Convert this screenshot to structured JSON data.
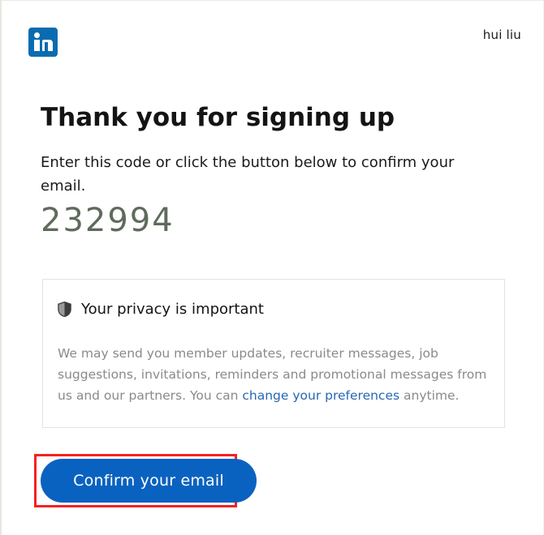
{
  "header": {
    "logo_icon": "linkedin-logo-icon",
    "logo_text": "in",
    "user_name": "hui liu"
  },
  "main": {
    "title": "Thank you for signing up",
    "subtitle": "Enter this code or click the button below to confirm your email.",
    "code": "232994"
  },
  "privacy": {
    "icon": "shield-icon",
    "title": "Your privacy is important",
    "body_before_link": "We may send you member updates, recruiter messages, job suggestions, invitations, reminders and promotional messages from us and our partners. You can ",
    "link_label": "change your preferences",
    "body_after_link": " anytime."
  },
  "cta": {
    "confirm_label": "Confirm your email"
  },
  "colors": {
    "linkedin_blue": "#0a6cb0",
    "button_blue": "#0a62c0",
    "link_blue": "#2867b2",
    "code_gray": "#5f6b5c",
    "body_gray": "#8a8a8a",
    "highlight_red": "#f72020",
    "box_border": "#e3e3e3"
  }
}
